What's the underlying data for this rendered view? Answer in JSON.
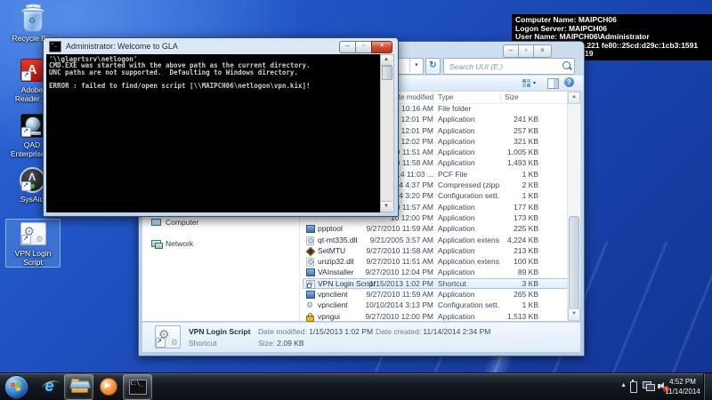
{
  "desktop": {
    "icons": [
      {
        "label": "Recycle Bin"
      },
      {
        "label": "Adobe\nReader XI"
      },
      {
        "label": "QAD\nEnterprise ..."
      },
      {
        "label": "SysAid"
      },
      {
        "label": "VPN Login\nScript",
        "selected": true
      }
    ],
    "bginfo": [
      "Computer Name: MAIPCH06",
      "Logon Server: MAIPCH06",
      "User Name: MAIPCH06\\Administrator",
      ".221 fe80::25cd:d29c:1cb3:1591",
      "19"
    ]
  },
  "cmd": {
    "title": "Administrator:  Welcome to GLA",
    "lines": [
      "'\\\\glaprtsrv\\netlogon'",
      "CMD.EXE was started with the above path as the current directory.",
      "UNC paths are not supported.  Defaulting to Windows directory.",
      "",
      "ERROR : failed to find/open script [\\\\MAIPCH06\\netlogon\\vpn.kix]!"
    ]
  },
  "explorer": {
    "search_placeholder": "Search UUI (E:)",
    "columns": {
      "date": "Date modified",
      "type": "Type",
      "size": "Size"
    },
    "sidebar": [
      {
        "label": "Computer"
      },
      {
        "label": "Network"
      }
    ],
    "files": [
      {
        "name": "",
        "date": "2 10:16 AM",
        "type": "File folder",
        "size": "",
        "icon": "none"
      },
      {
        "name": "",
        "date": "10 12:01 PM",
        "type": "Application",
        "size": "241 KB",
        "icon": "none"
      },
      {
        "name": "",
        "date": "10 12:01 PM",
        "type": "Application",
        "size": "257 KB",
        "icon": "none"
      },
      {
        "name": "",
        "date": "10 12:02 PM",
        "type": "Application",
        "size": "321 KB",
        "icon": "none"
      },
      {
        "name": "",
        "date": "10 11:51 AM",
        "type": "Application",
        "size": "1,005 KB",
        "icon": "none"
      },
      {
        "name": "",
        "date": "10 11:58 AM",
        "type": "Application",
        "size": "1,493 KB",
        "icon": "none"
      },
      {
        "name": "",
        "date": "014 11:03 ...",
        "type": "PCF File",
        "size": "1 KB",
        "icon": "none"
      },
      {
        "name": "",
        "date": "014 4:37 PM",
        "type": "Compressed (zipp...",
        "size": "2 KB",
        "icon": "none"
      },
      {
        "name": "",
        "date": "014 3:20 PM",
        "type": "Configuration sett...",
        "size": "1 KB",
        "icon": "none"
      },
      {
        "name": "",
        "date": "10 11:57 AM",
        "type": "Application",
        "size": "177 KB",
        "icon": "none"
      },
      {
        "name": "",
        "date": "10 12:00 PM",
        "type": "Application",
        "size": "173 KB",
        "icon": "none"
      },
      {
        "name": "ppptool",
        "date": "9/27/2010 11:59 AM",
        "type": "Application",
        "size": "225 KB",
        "icon": "app"
      },
      {
        "name": "qt-mt335.dll",
        "date": "9/21/2005 3:57 AM",
        "type": "Application extens...",
        "size": "4,224 KB",
        "icon": "dll"
      },
      {
        "name": "SetMTU",
        "date": "9/27/2010 11:58 AM",
        "type": "Application",
        "size": "213 KB",
        "icon": "setmtu"
      },
      {
        "name": "unzip32.dll",
        "date": "9/27/2010 11:51 AM",
        "type": "Application extens...",
        "size": "100 KB",
        "icon": "dll"
      },
      {
        "name": "VAInstaller",
        "date": "9/27/2010 12:04 PM",
        "type": "Application",
        "size": "89 KB",
        "icon": "app"
      },
      {
        "name": "VPN Login Script",
        "date": "1/15/2013 1:02 PM",
        "type": "Shortcut",
        "size": "3 KB",
        "icon": "shortcut",
        "selected": true
      },
      {
        "name": "vpnclient",
        "date": "9/27/2010 11:59 AM",
        "type": "Application",
        "size": "265 KB",
        "icon": "app"
      },
      {
        "name": "vpnclient",
        "date": "10/10/2014 3:13 PM",
        "type": "Configuration sett...",
        "size": "1 KB",
        "icon": "config"
      },
      {
        "name": "vpngui",
        "date": "9/27/2010 12:00 PM",
        "type": "Application",
        "size": "1,513 KB",
        "icon": "lock"
      }
    ],
    "details": {
      "name": "VPN Login Script",
      "type": "Shortcut",
      "date_modified_label": "Date modified:",
      "date_modified": "1/15/2013 1:02 PM",
      "size_label": "Size:",
      "size": "2.09 KB",
      "date_created_label": "Date created:",
      "date_created": "11/14/2014 2:34 PM"
    }
  },
  "taskbar": {
    "time": "4:52 PM",
    "date": "11/14/2014"
  },
  "glyphs": {
    "minimize": "–",
    "maximize": "▫",
    "close": "×",
    "chevron_down": "▾",
    "refresh": "↻",
    "help": "?",
    "scroll_up": "▲",
    "scroll_down": "▼",
    "recycle": "♻",
    "adobe_a": "A",
    "sysaid_a": "Λ",
    "gear": "⚙",
    "shortcut_arrow": "↗",
    "ie_e": "e",
    "tray_chevron": "▲",
    "muted": "–"
  },
  "colors": {
    "accent_blue": "#2d7ac0",
    "close_red": "#c9472c",
    "selection_blue": "#dcebfa",
    "wallpaper_blue": "#1f4fc0"
  }
}
